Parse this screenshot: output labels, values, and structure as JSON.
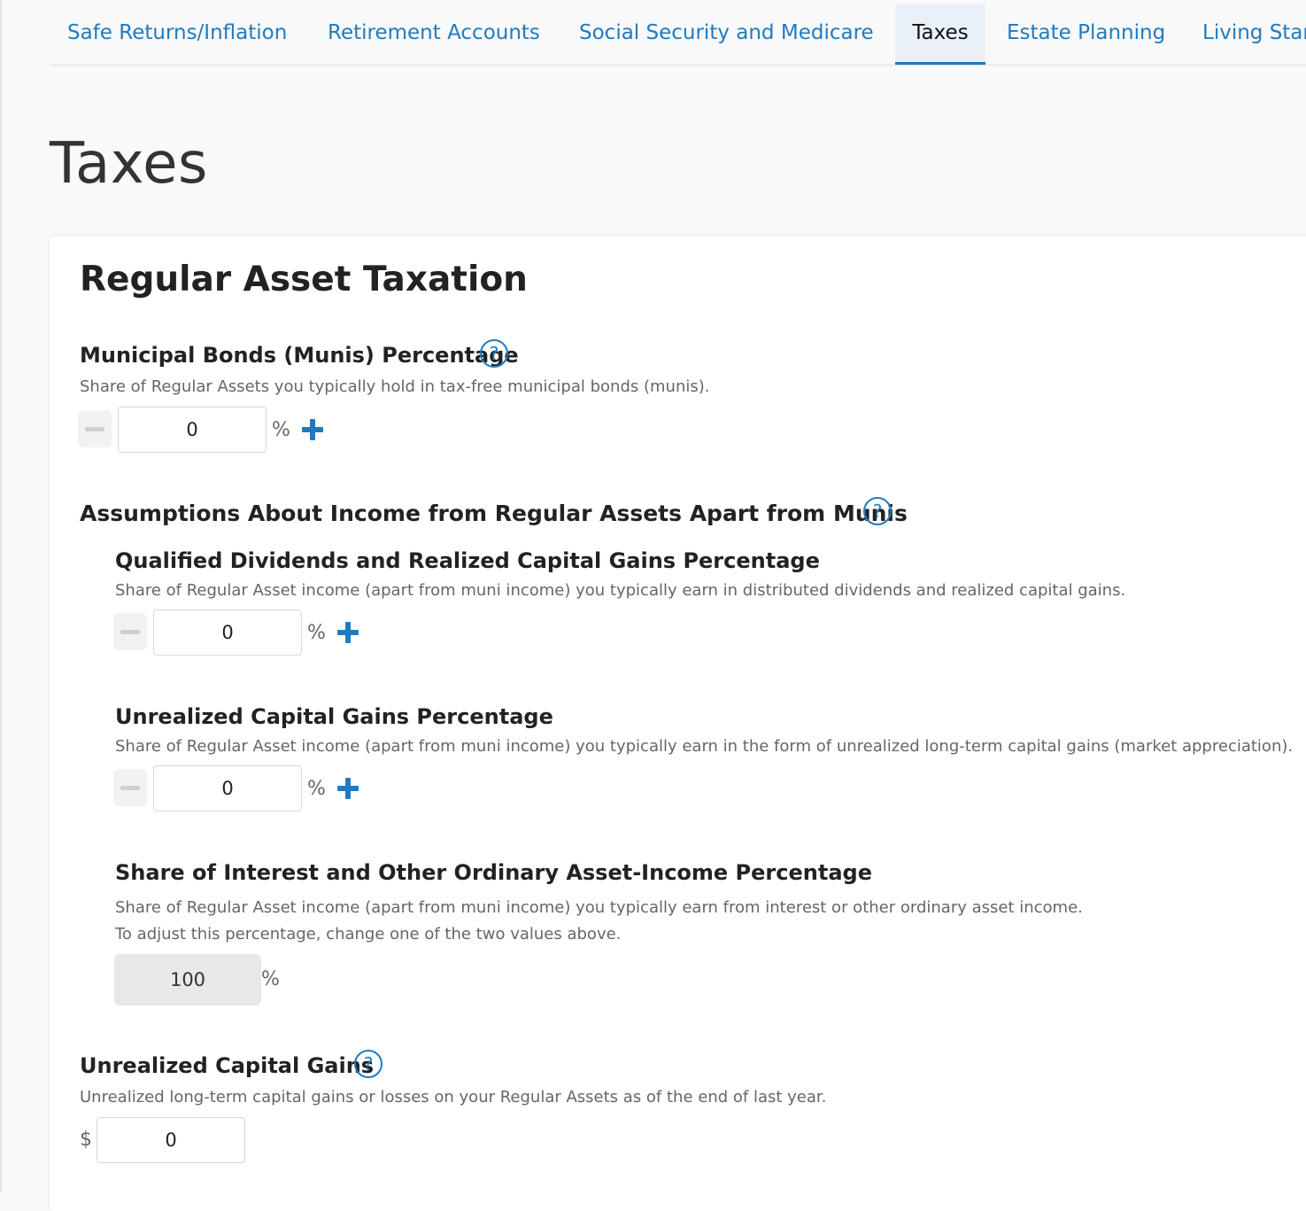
{
  "tabs": [
    {
      "label": "Safe Returns/Inflation"
    },
    {
      "label": "Retirement Accounts"
    },
    {
      "label": "Social Security and Medicare"
    },
    {
      "label": "Taxes",
      "active": true
    },
    {
      "label": "Estate Planning"
    },
    {
      "label": "Living Star"
    }
  ],
  "page": {
    "title": "Taxes"
  },
  "card": {
    "title": "Regular Asset Taxation",
    "munis": {
      "label": "Municipal Bonds (Munis) Percentage",
      "help": "?",
      "desc": "Share of Regular Assets you typically hold in tax-free municipal bonds (munis).",
      "value": "0",
      "unit": "%"
    },
    "assumptions": {
      "label": "Assumptions About Income from Regular Assets Apart from Munis",
      "help": "?",
      "qualified": {
        "label": "Qualified Dividends and Realized Capital Gains Percentage",
        "desc": "Share of Regular Asset income (apart from muni income) you typically earn in distributed dividends and realized capital gains.",
        "value": "0",
        "unit": "%"
      },
      "unrealized_pct": {
        "label": "Unrealized Capital Gains Percentage",
        "desc": "Share of Regular Asset income (apart from muni income) you typically earn in the form of unrealized long-term capital gains (market appreciation).",
        "value": "0",
        "unit": "%"
      },
      "interest": {
        "label": "Share of Interest and Other Ordinary Asset-Income Percentage",
        "desc1": "Share of Regular Asset income (apart from muni income) you typically earn from interest or other ordinary asset income.",
        "desc2": "To adjust this percentage, change one of the two values above.",
        "value": "100",
        "unit": "%"
      }
    },
    "unrealized_gains": {
      "label": "Unrealized Capital Gains",
      "help": "?",
      "desc": "Unrealized long-term capital gains or losses on your Regular Assets as of the end of last year.",
      "currency": "$",
      "value": "0"
    }
  },
  "colors": {
    "accent": "#1f7bc1",
    "readonly_bg": "#e6e8ea"
  }
}
